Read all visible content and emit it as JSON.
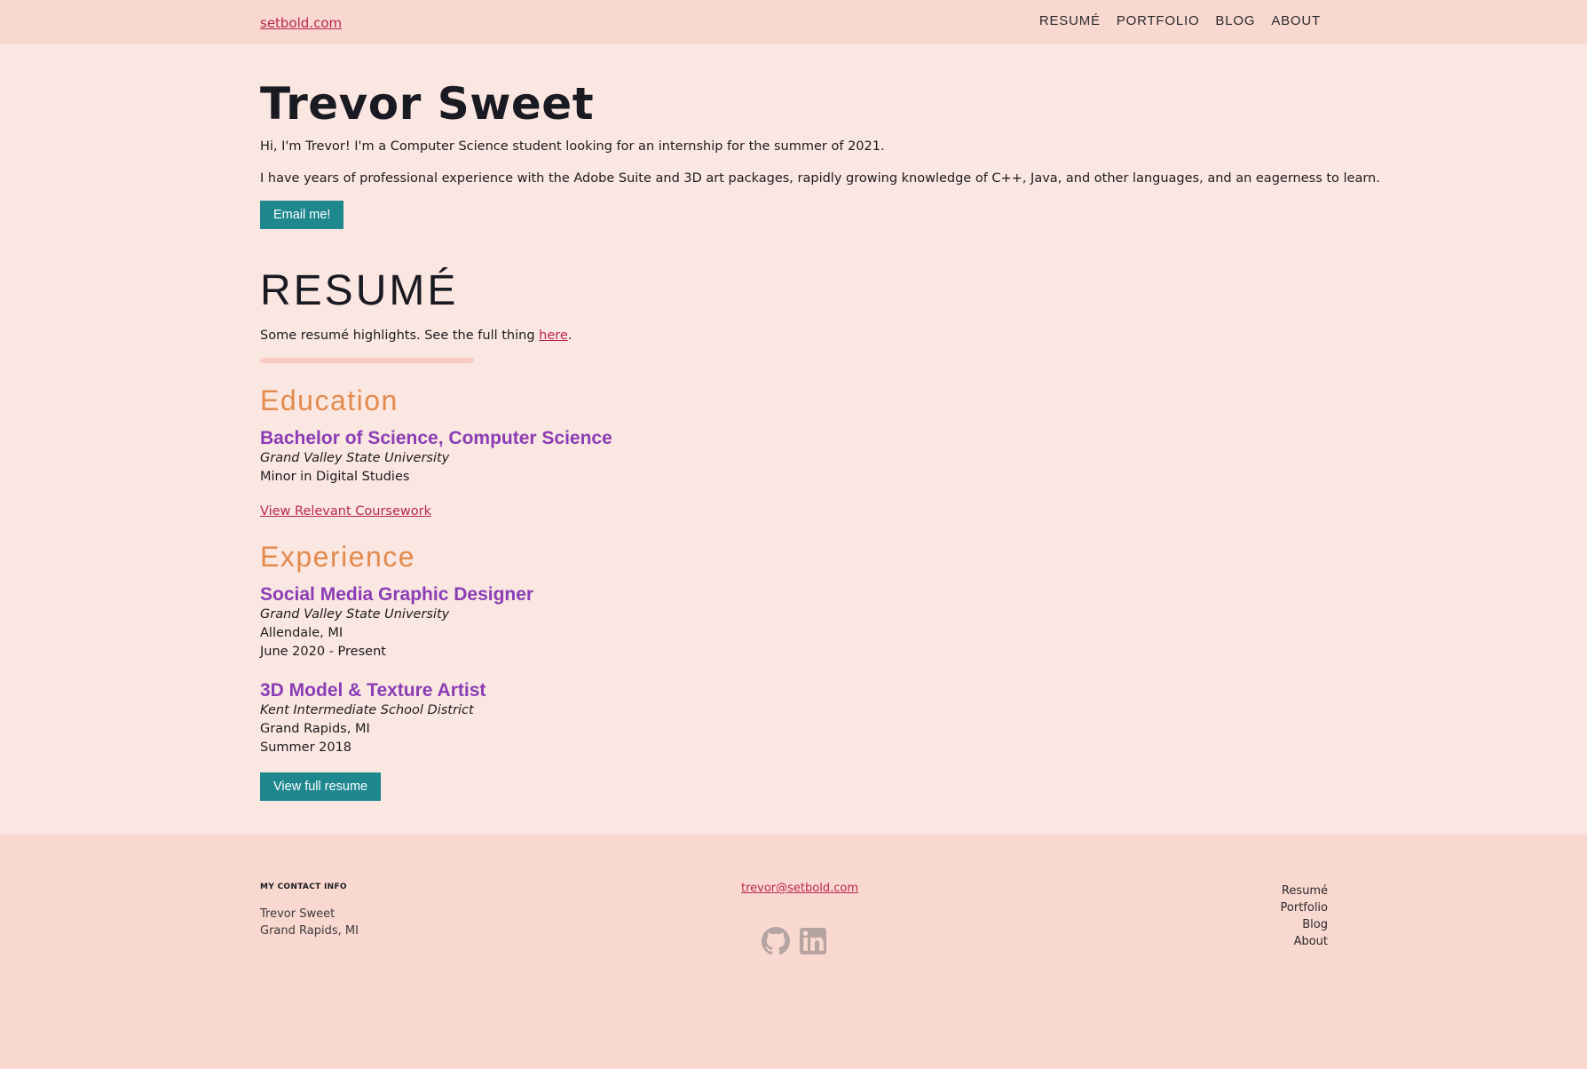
{
  "header": {
    "brand": "setbold.com",
    "nav": [
      "RESUMÉ",
      "PORTFOLIO",
      "BLOG",
      "ABOUT"
    ]
  },
  "intro": {
    "name": "Trevor Sweet",
    "para1": "Hi, I'm Trevor! I'm a Computer Science student looking for an internship for the summer of 2021.",
    "para2": "I have years of professional experience with the Adobe Suite and 3D art packages, rapidly growing knowledge of C++, Java, and other languages, and an eagerness to learn.",
    "email_button": "Email me!"
  },
  "resume": {
    "heading": "RESUMÉ",
    "highlights_prefix": "Some resumé highlights. See the full thing ",
    "highlights_link": "here",
    "highlights_suffix": ".",
    "education": {
      "heading": "Education",
      "degree": "Bachelor of Science, Computer Science",
      "school": "Grand Valley State University",
      "minor": "Minor in Digital Studies",
      "coursework_link": "View Relevant Coursework"
    },
    "experience": {
      "heading": "Experience",
      "jobs": [
        {
          "title": "Social Media Graphic Designer",
          "org": "Grand Valley State University",
          "location": "Allendale, MI",
          "dates": "June 2020 - Present"
        },
        {
          "title": "3D Model & Texture Artist",
          "org": "Kent Intermediate School District",
          "location": "Grand Rapids, MI",
          "dates": "Summer 2018"
        }
      ]
    },
    "full_button": "View full resume"
  },
  "footer": {
    "contact_heading": "MY CONTACT INFO",
    "contact_name": "Trevor Sweet",
    "contact_location": "Grand Rapids, MI",
    "email": "trevor@setbold.com",
    "social_icons": [
      "github-icon",
      "linkedin-icon"
    ],
    "links": [
      "Resumé",
      "Portfolio",
      "Blog",
      "About"
    ]
  },
  "colors": {
    "background": "#fbe7e1",
    "bar": "#f9d8d0",
    "button": "#1f878e",
    "link": "#b8264f",
    "section_heading": "#e38a4c",
    "entry_title": "#8a3db5"
  }
}
